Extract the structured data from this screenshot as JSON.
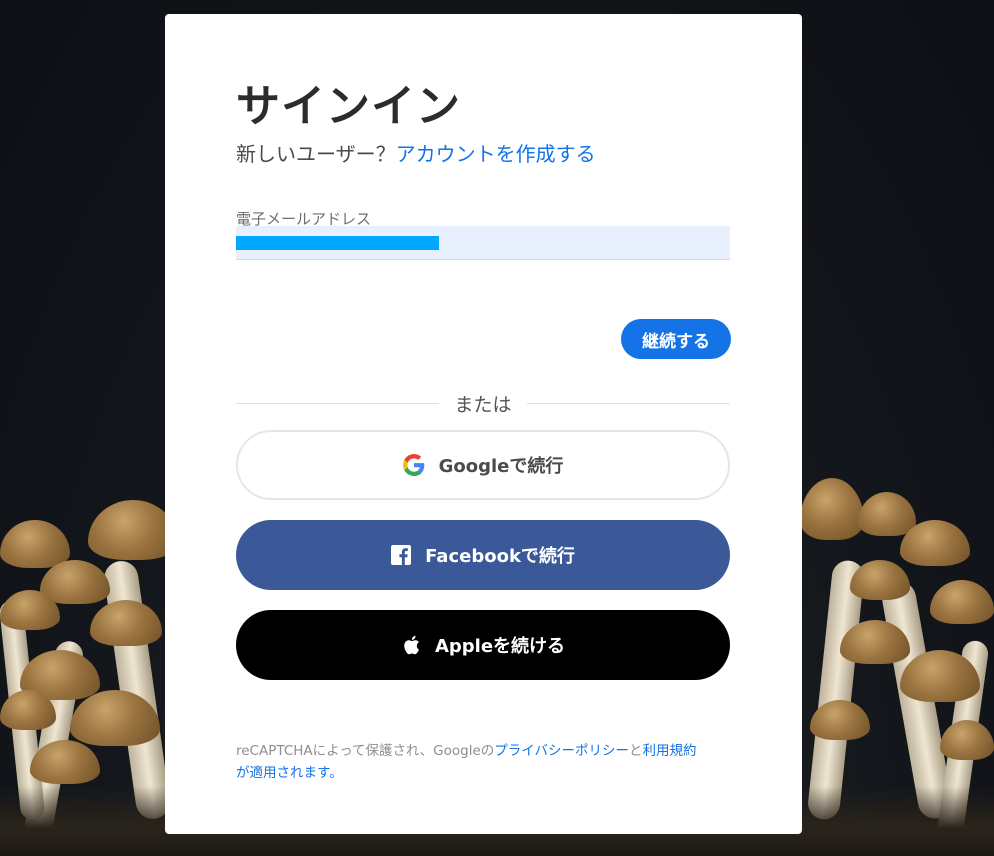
{
  "signin": {
    "title": "サインイン",
    "new_user_text": "新しいユーザー？",
    "create_account_link": "アカウントを作成する",
    "email_label": "電子メールアドレス",
    "email_value": "",
    "continue_button": "継続する",
    "divider_text": "または",
    "google_button": "Googleで続行",
    "facebook_button": "Facebookで続行",
    "apple_button": "Appleを続ける"
  },
  "recaptcha": {
    "prefix": "reCAPTCHAによって保護され、Googleの",
    "privacy_link": "プライバシーポリシー",
    "and": "と",
    "terms_link": "利用規約",
    "suffix": "が適用されます。"
  },
  "colors": {
    "accent": "#1473e6",
    "facebook": "#3b5998",
    "apple": "#000000",
    "autofill": "#e8f0fe"
  },
  "icons": [
    "google-icon",
    "facebook-icon",
    "apple-icon"
  ]
}
